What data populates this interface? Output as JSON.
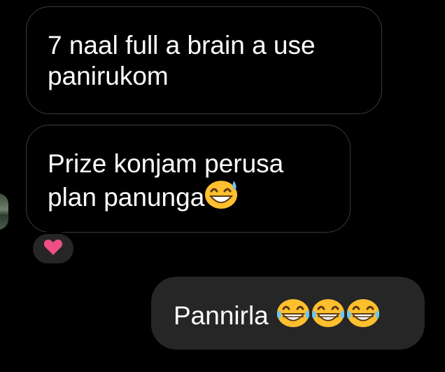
{
  "thread": {
    "messages": [
      {
        "sender": "other",
        "text": "7 naal full a brain a use panirukom"
      },
      {
        "sender": "other",
        "text": "Prize konjam perusa plan panunga",
        "emoji": "grinning-sweat-emoji"
      },
      {
        "sender": "me",
        "text": "Pannirla",
        "emojis": [
          "tears-of-joy-emoji",
          "tears-of-joy-emoji",
          "tears-of-joy-emoji"
        ]
      }
    ],
    "reaction": {
      "icon": "heart-icon",
      "color": "#ee4f86"
    }
  }
}
